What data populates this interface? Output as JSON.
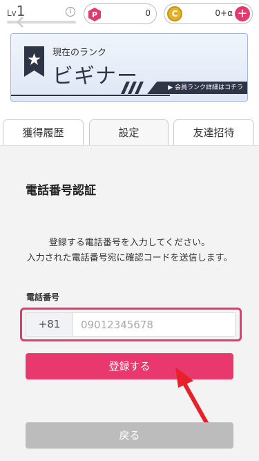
{
  "header": {
    "level_label": "Lv",
    "level_value": "1",
    "info_icon": "info-icon",
    "points_value": "0",
    "points_icon_letter": "P",
    "coins_value": "0+α",
    "coins_icon_letter": "C",
    "plus_label": "+"
  },
  "rank": {
    "title": "現在のランク",
    "name": "ビギナー",
    "link_label": "▶ 会員ランク詳細はコチラ"
  },
  "tabs": [
    {
      "label": "獲得履歴",
      "active": false
    },
    {
      "label": "設定",
      "active": true
    },
    {
      "label": "友達招待",
      "active": false
    }
  ],
  "form": {
    "title": "電話番号認証",
    "description_line1": "登録する電話番号を入力してください。",
    "description_line2": "入力された電話番号宛に確認コードを送信します。",
    "phone_label": "電話番号",
    "country_code": "+81",
    "phone_placeholder": "09012345678",
    "phone_value": "",
    "register_label": "登録する",
    "back_label": "戻る"
  },
  "colors": {
    "accent": "#e8386d",
    "rank_dark": "#2e3547",
    "disabled": "#bcbcbc"
  }
}
